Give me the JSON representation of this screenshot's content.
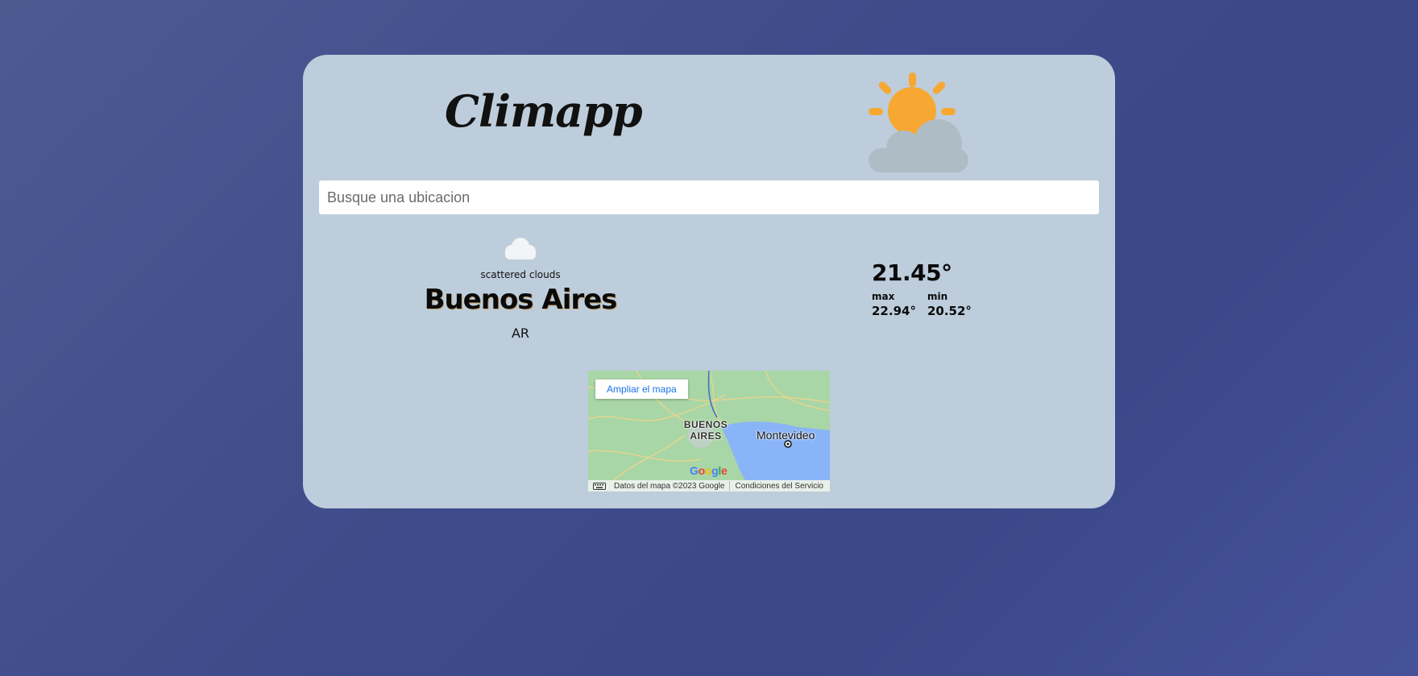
{
  "app": {
    "title": "Climapp",
    "logo_icon": "sun-behind-cloud-icon"
  },
  "search": {
    "placeholder": "Busque una ubicacion",
    "value": ""
  },
  "weather": {
    "condition_icon": "cloud-icon",
    "description": "scattered clouds",
    "city": "Buenos Aires",
    "country": "AR",
    "temperature": "21.45°",
    "max_label": "max",
    "max_value": "22.94°",
    "min_label": "min",
    "min_value": "20.52°"
  },
  "map": {
    "expand_label": "Ampliar el mapa",
    "city_label": "BUENOS AIRES",
    "other_city_label": "Montevideo",
    "provider": "Google",
    "data_label": "Datos del mapa ©2023 Google",
    "terms_label": "Condiciones del Servicio",
    "keyboard_icon": "keyboard-icon"
  },
  "colors": {
    "card_background": "#bdcddb",
    "sun": "#f7a833",
    "cloud_grey": "#aebcc5",
    "water": "#8ab4f8",
    "land": "#a9d6a6"
  }
}
